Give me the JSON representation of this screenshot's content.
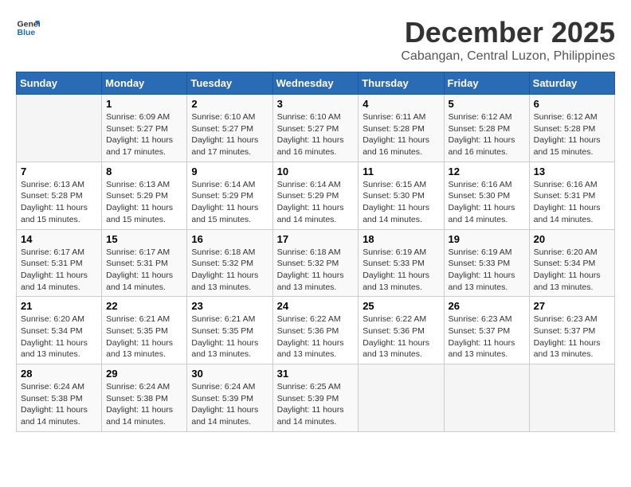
{
  "logo": {
    "line1": "General",
    "line2": "Blue"
  },
  "title": "December 2025",
  "subtitle": "Cabangan, Central Luzon, Philippines",
  "days_of_week": [
    "Sunday",
    "Monday",
    "Tuesday",
    "Wednesday",
    "Thursday",
    "Friday",
    "Saturday"
  ],
  "weeks": [
    [
      {
        "day": "",
        "sunrise": "",
        "sunset": "",
        "daylight": ""
      },
      {
        "day": "1",
        "sunrise": "Sunrise: 6:09 AM",
        "sunset": "Sunset: 5:27 PM",
        "daylight": "Daylight: 11 hours and 17 minutes."
      },
      {
        "day": "2",
        "sunrise": "Sunrise: 6:10 AM",
        "sunset": "Sunset: 5:27 PM",
        "daylight": "Daylight: 11 hours and 17 minutes."
      },
      {
        "day": "3",
        "sunrise": "Sunrise: 6:10 AM",
        "sunset": "Sunset: 5:27 PM",
        "daylight": "Daylight: 11 hours and 16 minutes."
      },
      {
        "day": "4",
        "sunrise": "Sunrise: 6:11 AM",
        "sunset": "Sunset: 5:28 PM",
        "daylight": "Daylight: 11 hours and 16 minutes."
      },
      {
        "day": "5",
        "sunrise": "Sunrise: 6:12 AM",
        "sunset": "Sunset: 5:28 PM",
        "daylight": "Daylight: 11 hours and 16 minutes."
      },
      {
        "day": "6",
        "sunrise": "Sunrise: 6:12 AM",
        "sunset": "Sunset: 5:28 PM",
        "daylight": "Daylight: 11 hours and 15 minutes."
      }
    ],
    [
      {
        "day": "7",
        "sunrise": "Sunrise: 6:13 AM",
        "sunset": "Sunset: 5:28 PM",
        "daylight": "Daylight: 11 hours and 15 minutes."
      },
      {
        "day": "8",
        "sunrise": "Sunrise: 6:13 AM",
        "sunset": "Sunset: 5:29 PM",
        "daylight": "Daylight: 11 hours and 15 minutes."
      },
      {
        "day": "9",
        "sunrise": "Sunrise: 6:14 AM",
        "sunset": "Sunset: 5:29 PM",
        "daylight": "Daylight: 11 hours and 15 minutes."
      },
      {
        "day": "10",
        "sunrise": "Sunrise: 6:14 AM",
        "sunset": "Sunset: 5:29 PM",
        "daylight": "Daylight: 11 hours and 14 minutes."
      },
      {
        "day": "11",
        "sunrise": "Sunrise: 6:15 AM",
        "sunset": "Sunset: 5:30 PM",
        "daylight": "Daylight: 11 hours and 14 minutes."
      },
      {
        "day": "12",
        "sunrise": "Sunrise: 6:16 AM",
        "sunset": "Sunset: 5:30 PM",
        "daylight": "Daylight: 11 hours and 14 minutes."
      },
      {
        "day": "13",
        "sunrise": "Sunrise: 6:16 AM",
        "sunset": "Sunset: 5:31 PM",
        "daylight": "Daylight: 11 hours and 14 minutes."
      }
    ],
    [
      {
        "day": "14",
        "sunrise": "Sunrise: 6:17 AM",
        "sunset": "Sunset: 5:31 PM",
        "daylight": "Daylight: 11 hours and 14 minutes."
      },
      {
        "day": "15",
        "sunrise": "Sunrise: 6:17 AM",
        "sunset": "Sunset: 5:31 PM",
        "daylight": "Daylight: 11 hours and 14 minutes."
      },
      {
        "day": "16",
        "sunrise": "Sunrise: 6:18 AM",
        "sunset": "Sunset: 5:32 PM",
        "daylight": "Daylight: 11 hours and 13 minutes."
      },
      {
        "day": "17",
        "sunrise": "Sunrise: 6:18 AM",
        "sunset": "Sunset: 5:32 PM",
        "daylight": "Daylight: 11 hours and 13 minutes."
      },
      {
        "day": "18",
        "sunrise": "Sunrise: 6:19 AM",
        "sunset": "Sunset: 5:33 PM",
        "daylight": "Daylight: 11 hours and 13 minutes."
      },
      {
        "day": "19",
        "sunrise": "Sunrise: 6:19 AM",
        "sunset": "Sunset: 5:33 PM",
        "daylight": "Daylight: 11 hours and 13 minutes."
      },
      {
        "day": "20",
        "sunrise": "Sunrise: 6:20 AM",
        "sunset": "Sunset: 5:34 PM",
        "daylight": "Daylight: 11 hours and 13 minutes."
      }
    ],
    [
      {
        "day": "21",
        "sunrise": "Sunrise: 6:20 AM",
        "sunset": "Sunset: 5:34 PM",
        "daylight": "Daylight: 11 hours and 13 minutes."
      },
      {
        "day": "22",
        "sunrise": "Sunrise: 6:21 AM",
        "sunset": "Sunset: 5:35 PM",
        "daylight": "Daylight: 11 hours and 13 minutes."
      },
      {
        "day": "23",
        "sunrise": "Sunrise: 6:21 AM",
        "sunset": "Sunset: 5:35 PM",
        "daylight": "Daylight: 11 hours and 13 minutes."
      },
      {
        "day": "24",
        "sunrise": "Sunrise: 6:22 AM",
        "sunset": "Sunset: 5:36 PM",
        "daylight": "Daylight: 11 hours and 13 minutes."
      },
      {
        "day": "25",
        "sunrise": "Sunrise: 6:22 AM",
        "sunset": "Sunset: 5:36 PM",
        "daylight": "Daylight: 11 hours and 13 minutes."
      },
      {
        "day": "26",
        "sunrise": "Sunrise: 6:23 AM",
        "sunset": "Sunset: 5:37 PM",
        "daylight": "Daylight: 11 hours and 13 minutes."
      },
      {
        "day": "27",
        "sunrise": "Sunrise: 6:23 AM",
        "sunset": "Sunset: 5:37 PM",
        "daylight": "Daylight: 11 hours and 13 minutes."
      }
    ],
    [
      {
        "day": "28",
        "sunrise": "Sunrise: 6:24 AM",
        "sunset": "Sunset: 5:38 PM",
        "daylight": "Daylight: 11 hours and 14 minutes."
      },
      {
        "day": "29",
        "sunrise": "Sunrise: 6:24 AM",
        "sunset": "Sunset: 5:38 PM",
        "daylight": "Daylight: 11 hours and 14 minutes."
      },
      {
        "day": "30",
        "sunrise": "Sunrise: 6:24 AM",
        "sunset": "Sunset: 5:39 PM",
        "daylight": "Daylight: 11 hours and 14 minutes."
      },
      {
        "day": "31",
        "sunrise": "Sunrise: 6:25 AM",
        "sunset": "Sunset: 5:39 PM",
        "daylight": "Daylight: 11 hours and 14 minutes."
      },
      {
        "day": "",
        "sunrise": "",
        "sunset": "",
        "daylight": ""
      },
      {
        "day": "",
        "sunrise": "",
        "sunset": "",
        "daylight": ""
      },
      {
        "day": "",
        "sunrise": "",
        "sunset": "",
        "daylight": ""
      }
    ]
  ]
}
